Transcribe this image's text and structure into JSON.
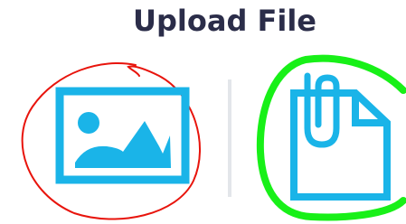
{
  "dialog": {
    "title": "Upload File"
  },
  "options": [
    {
      "icon": "image-icon",
      "accent": "#1ab4e8",
      "annotation_color": "#e8140c"
    },
    {
      "icon": "document-attachment-icon",
      "accent": "#1ab4e8",
      "annotation_color": "#18f018"
    }
  ],
  "colors": {
    "title": "#2b2d49",
    "icon": "#1ab4e8",
    "divider": "#e3e6ea",
    "red_annotation": "#e8140c",
    "green_annotation": "#18f018"
  }
}
